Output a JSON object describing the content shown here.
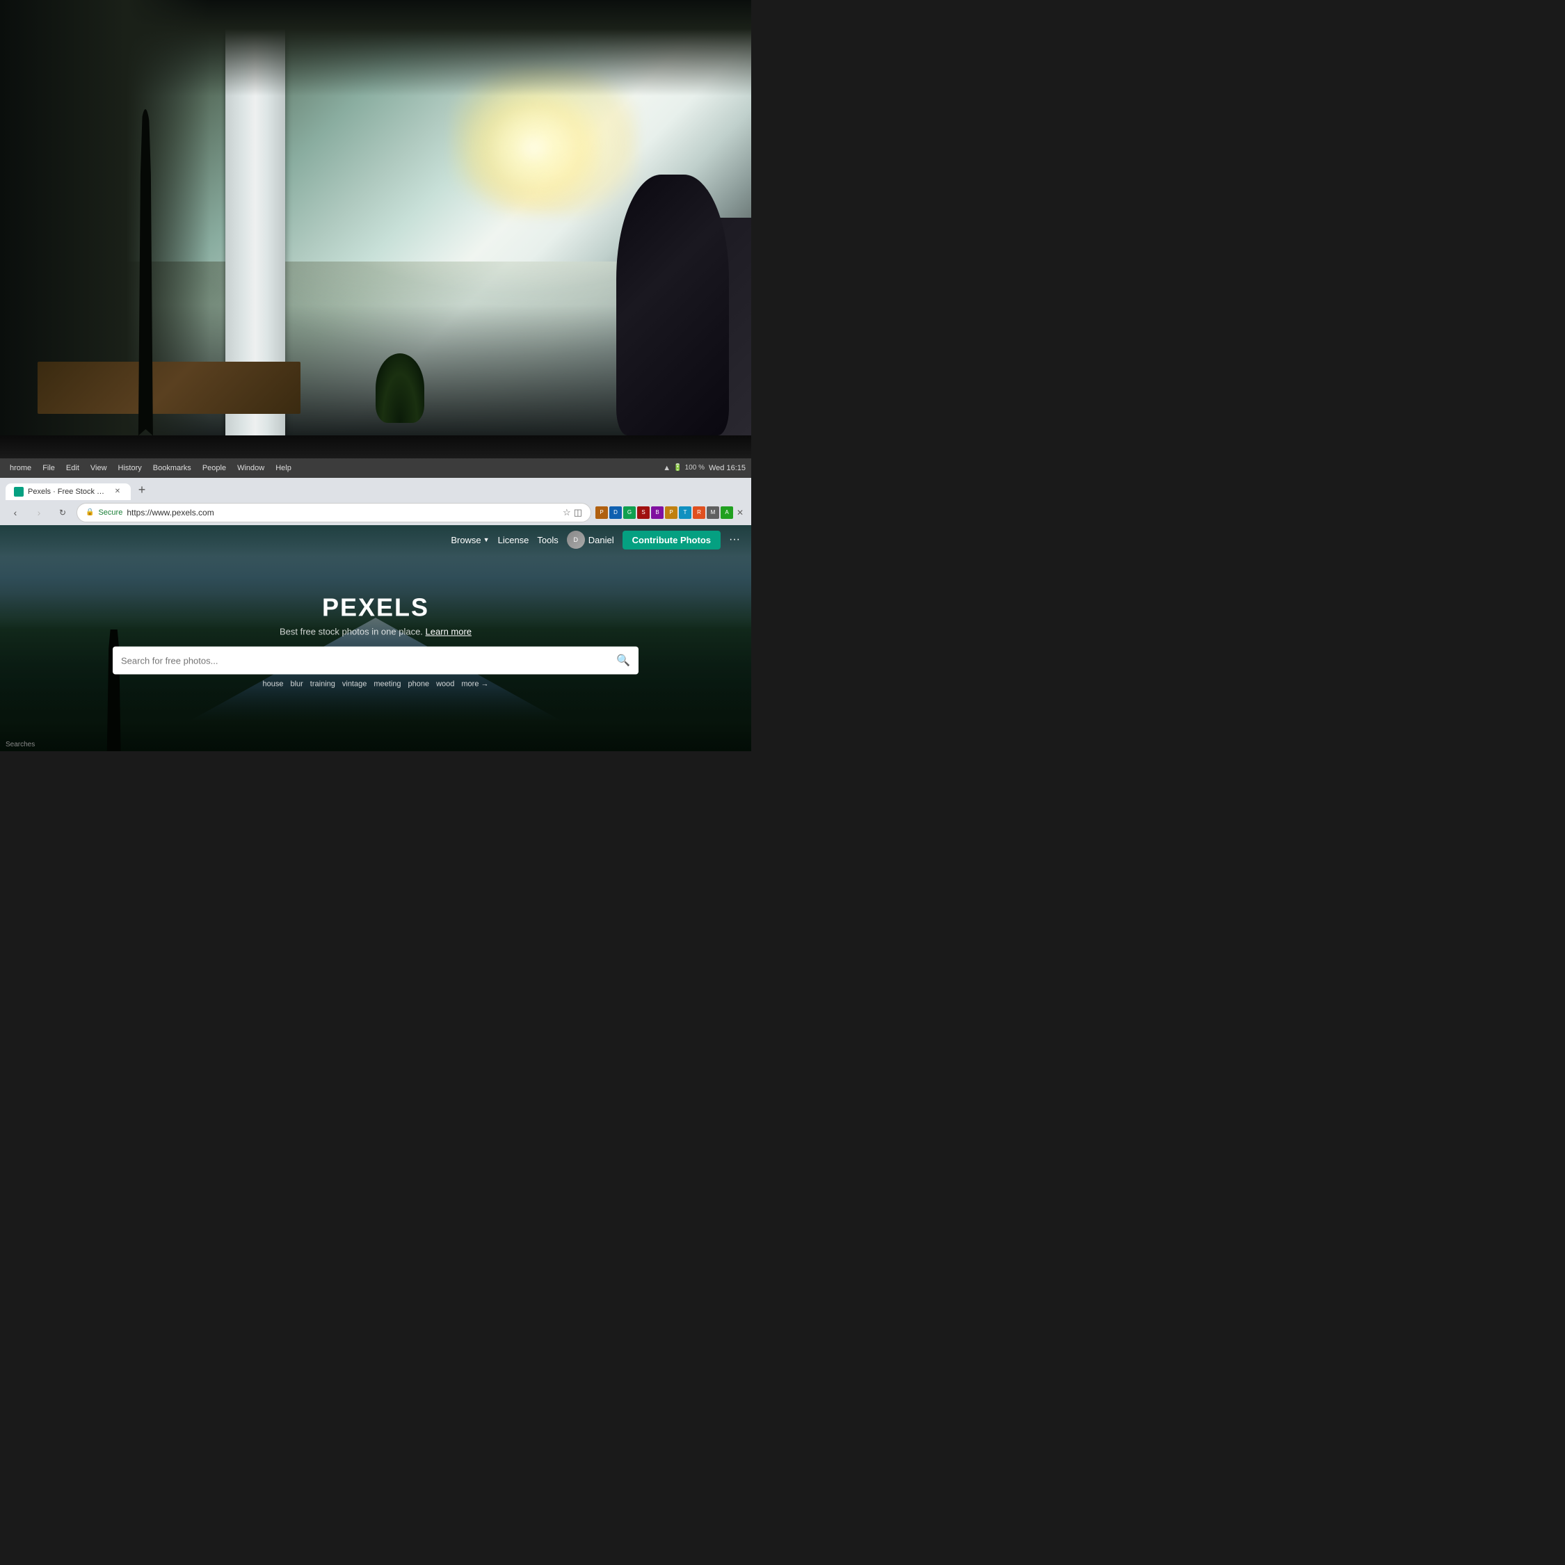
{
  "background": {
    "description": "Office interior photo - upper half of screen"
  },
  "monitor_frame": {
    "description": "Dark monitor bezel separating photo from screen"
  },
  "os_bar": {
    "menu_items": [
      "hrome",
      "File",
      "Edit",
      "View",
      "History",
      "Bookmarks",
      "People",
      "Window",
      "Help"
    ],
    "right_info": {
      "time": "Wed 16:15",
      "battery": "100 %"
    }
  },
  "browser": {
    "tab": {
      "favicon_color": "#05a081",
      "title": "Pexels · Free Stock Photos"
    },
    "url_bar": {
      "secure_label": "Secure",
      "url": "https://www.pexels.com"
    }
  },
  "pexels": {
    "nav": {
      "browse_label": "Browse",
      "license_label": "License",
      "tools_label": "Tools",
      "username": "Daniel",
      "contribute_label": "Contribute Photos",
      "more_label": "···"
    },
    "hero": {
      "logo": "PEXELS",
      "tagline": "Best free stock photos in one place.",
      "learn_more": "Learn more",
      "search_placeholder": "Search for free photos...",
      "tags": [
        "house",
        "blur",
        "training",
        "vintage",
        "meeting",
        "phone",
        "wood"
      ],
      "more_label": "more →"
    }
  },
  "bottom": {
    "searches_label": "Searches"
  }
}
